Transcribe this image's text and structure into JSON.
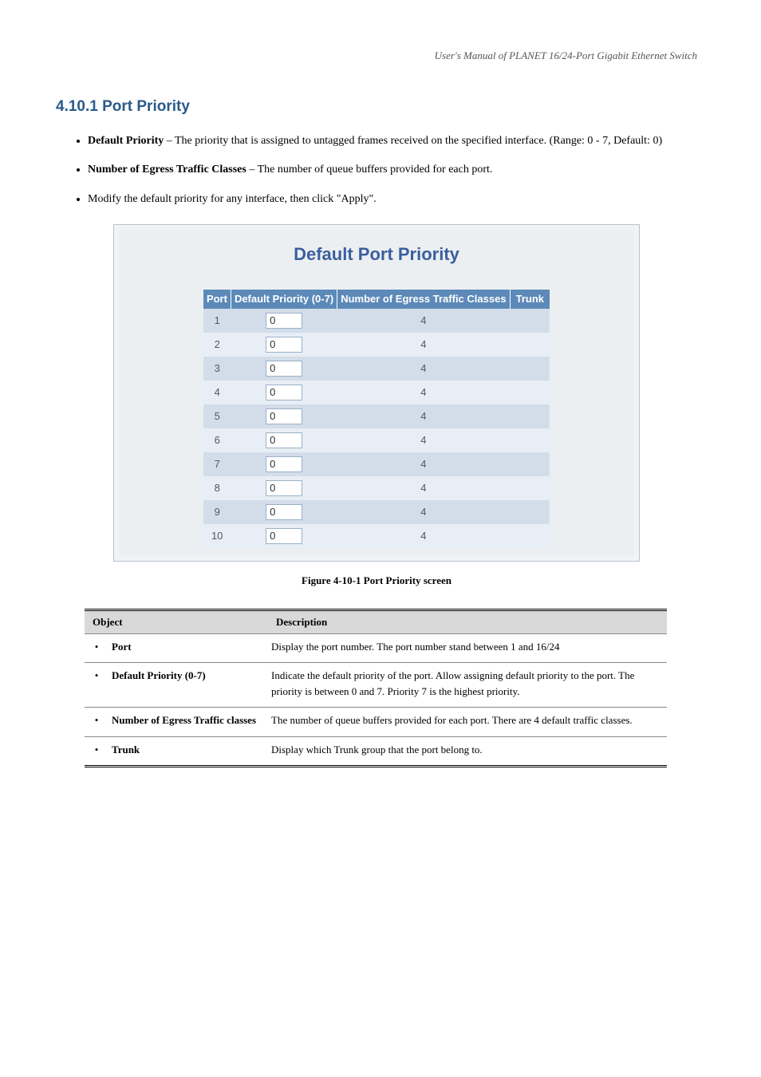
{
  "page_header": "User's Manual of PLANET 16/24-Port Gigabit Ethernet Switch",
  "section_title": "4.10.1 Port Priority",
  "bullets": [
    {
      "label": "Default Priority",
      "text": " – The priority that is assigned to untagged frames received on the specified interface. (Range: 0 - 7, Default: 0)"
    },
    {
      "label": "Number of Egress Traffic Classes",
      "text": " – The number of queue buffers provided for each port."
    },
    {
      "label": null,
      "text": "Modify the default priority for any interface, then click \"Apply\"."
    }
  ],
  "figure": {
    "title": "Default Port Priority",
    "headers": [
      "Port",
      "Default Priority (0-7)",
      "Number of Egress Traffic Classes",
      "Trunk"
    ],
    "rows": [
      {
        "port": "1",
        "priority": "0",
        "classes": "4",
        "trunk": ""
      },
      {
        "port": "2",
        "priority": "0",
        "classes": "4",
        "trunk": ""
      },
      {
        "port": "3",
        "priority": "0",
        "classes": "4",
        "trunk": ""
      },
      {
        "port": "4",
        "priority": "0",
        "classes": "4",
        "trunk": ""
      },
      {
        "port": "5",
        "priority": "0",
        "classes": "4",
        "trunk": ""
      },
      {
        "port": "6",
        "priority": "0",
        "classes": "4",
        "trunk": ""
      },
      {
        "port": "7",
        "priority": "0",
        "classes": "4",
        "trunk": ""
      },
      {
        "port": "8",
        "priority": "0",
        "classes": "4",
        "trunk": ""
      },
      {
        "port": "9",
        "priority": "0",
        "classes": "4",
        "trunk": ""
      },
      {
        "port": "10",
        "priority": "0",
        "classes": "4",
        "trunk": ""
      }
    ],
    "caption": "Figure 4-10-1 Port Priority screen"
  },
  "info_table": {
    "headers": [
      "Object",
      "Description"
    ],
    "rows": [
      {
        "object": "Port",
        "desc": "Display the port number. The port number stand between 1 and 16/24"
      },
      {
        "object": "Default Priority (0-7)",
        "desc": "Indicate the default priority of the port. Allow assigning default priority to the port. The priority is between 0 and 7. Priority 7 is the highest priority."
      },
      {
        "object": "Number of Egress Traffic classes",
        "desc": "The number of queue buffers provided for each port. There are 4 default traffic classes."
      },
      {
        "object": "Trunk",
        "desc": "Display which Trunk group that the port belong to."
      }
    ]
  }
}
